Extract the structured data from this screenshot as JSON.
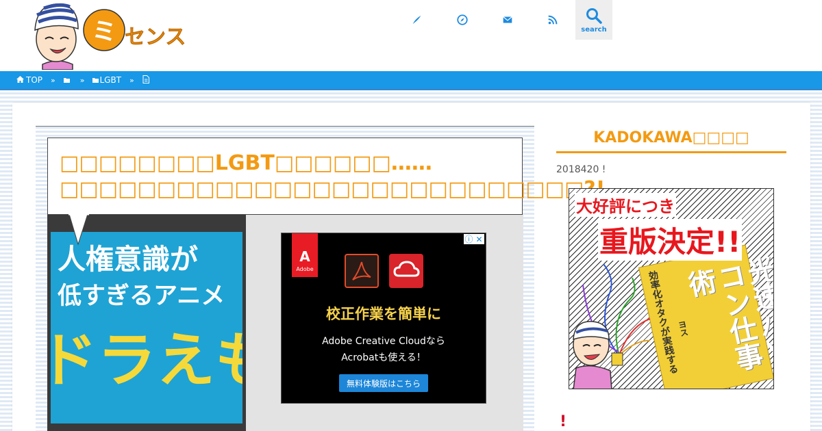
{
  "header": {
    "logo_text": "ミッセンス",
    "logo_badge": "ミ",
    "nav": [
      {
        "icon": "pen-icon"
      },
      {
        "icon": "compass-icon"
      },
      {
        "icon": "mail-icon"
      },
      {
        "icon": "rss-icon"
      }
    ],
    "search_label": "search"
  },
  "breadcrumb": {
    "home": "TOP",
    "separator": "»",
    "category": "LGBT"
  },
  "article": {
    "title": "□□□□□□□□LGBT□□□□□□……□□□□□□□□□□□□□□□□□□□□□□□□□□□?!",
    "eyecatch_line1": "人権意識が",
    "eyecatch_line2": "低すぎるアニメ",
    "eyecatch_line3": "ドラえも"
  },
  "ad": {
    "adobe_letter": "A",
    "adobe_word": "Adobe",
    "info_icon": "ⓘ",
    "close_icon": "✕",
    "headline": "校正作業を簡単に",
    "body_line1": "Adobe Creative Cloudなら",
    "body_line2": "Acrobatも使える！",
    "cta": "無料体験版はこちら"
  },
  "sidebar": {
    "title": "KADOKAWA□□□□",
    "date_text": "2018420 !",
    "banner_line1": "大好評につき",
    "banner_line2": "重版決定!!",
    "book_subtitle": "効率化オタクが実践する",
    "book_title": "光速パソコン仕事術",
    "book_author": "ヨス",
    "next_heading": "!"
  },
  "colors": {
    "accent_orange": "#f39a12",
    "nav_blue": "#1898e6",
    "title_red": "#e8171e"
  }
}
